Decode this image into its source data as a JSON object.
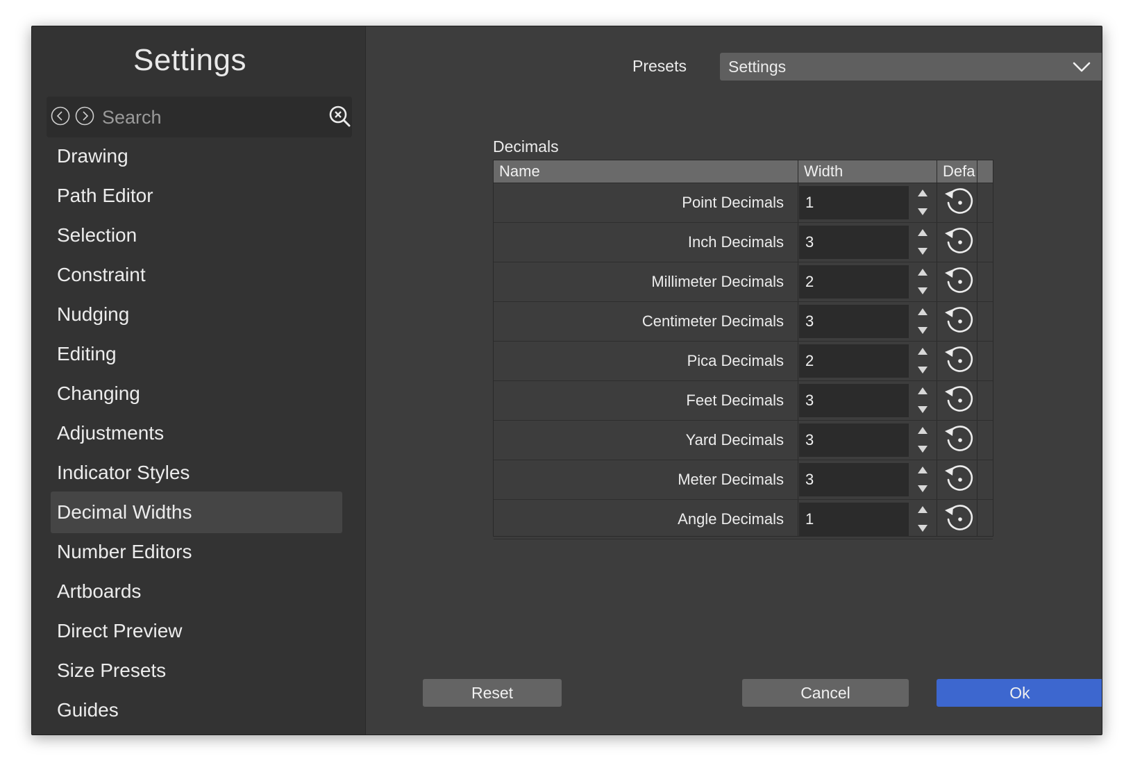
{
  "sidebar": {
    "title": "Settings",
    "search_placeholder": "Search",
    "items": [
      {
        "label": "Drawing"
      },
      {
        "label": "Path Editor"
      },
      {
        "label": "Selection"
      },
      {
        "label": "Constraint"
      },
      {
        "label": "Nudging"
      },
      {
        "label": "Editing"
      },
      {
        "label": "Changing"
      },
      {
        "label": "Adjustments"
      },
      {
        "label": "Indicator Styles"
      },
      {
        "label": "Decimal Widths"
      },
      {
        "label": "Number Editors"
      },
      {
        "label": "Artboards"
      },
      {
        "label": "Direct Preview"
      },
      {
        "label": "Size Presets"
      },
      {
        "label": "Guides"
      }
    ],
    "selected_item": "Decimal Widths"
  },
  "presets": {
    "label": "Presets",
    "value": "Settings"
  },
  "group": {
    "label": "Decimals",
    "columns": [
      "Name",
      "Width",
      "Defa"
    ],
    "rows": [
      {
        "name": "Point Decimals",
        "width": "1"
      },
      {
        "name": "Inch Decimals",
        "width": "3"
      },
      {
        "name": "Millimeter Decimals",
        "width": "2"
      },
      {
        "name": "Centimeter Decimals",
        "width": "3"
      },
      {
        "name": "Pica Decimals",
        "width": "2"
      },
      {
        "name": "Feet Decimals",
        "width": "3"
      },
      {
        "name": "Yard Decimals",
        "width": "3"
      },
      {
        "name": "Meter Decimals",
        "width": "3"
      },
      {
        "name": "Angle Decimals",
        "width": "1"
      }
    ]
  },
  "buttons": {
    "reset": "Reset",
    "cancel": "Cancel",
    "ok": "Ok"
  },
  "colors": {
    "window_bg": "#3d3d3d",
    "sidebar_bg": "#333333",
    "accent": "#3d67cf"
  }
}
